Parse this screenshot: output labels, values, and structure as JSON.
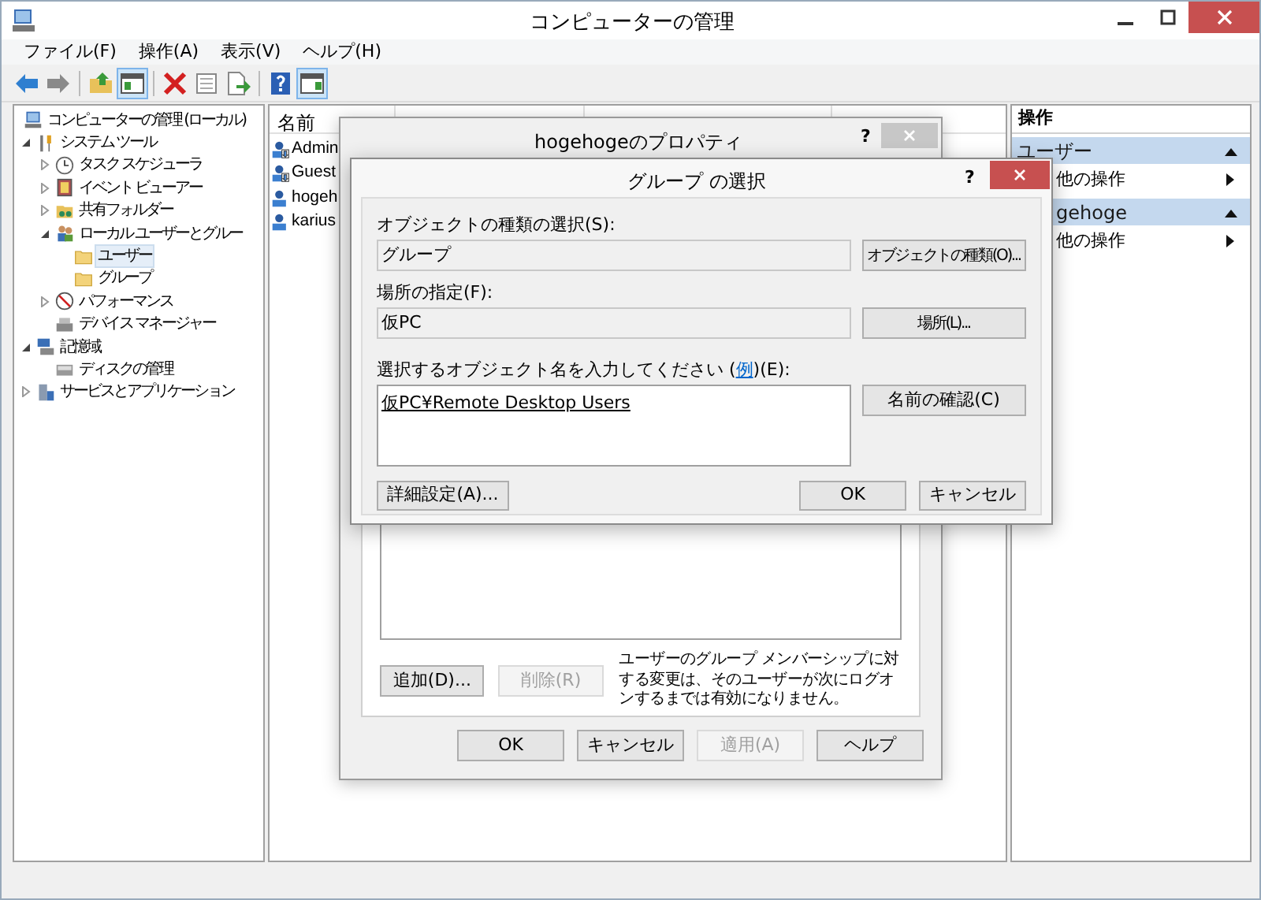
{
  "window": {
    "title": "コンピューターの管理"
  },
  "menu": [
    "ファイル(F)",
    "操作(A)",
    "表示(V)",
    "ヘルプ(H)"
  ],
  "toolbar": [
    [
      {
        "kind": "back",
        "pressed": false
      },
      {
        "kind": "forward",
        "pressed": false
      }
    ],
    [
      {
        "kind": "up",
        "pressed": false
      },
      {
        "kind": "tree",
        "pressed": true
      }
    ],
    [
      {
        "kind": "delete",
        "pressed": false
      },
      {
        "kind": "properties",
        "pressed": false
      },
      {
        "kind": "export",
        "pressed": false
      }
    ],
    [
      {
        "kind": "help",
        "pressed": false
      },
      {
        "kind": "action-pane",
        "pressed": true
      }
    ]
  ],
  "tree": [
    {
      "label": "コンピューターの管理 (ローカル)",
      "kind": "computer",
      "selected": false,
      "children": [
        {
          "label": "システム ツール",
          "kind": "tools",
          "expanded": true,
          "selected": false,
          "children": [
            {
              "label": "タスク スケジューラ",
              "kind": "clock",
              "expanded": false,
              "selected": false
            },
            {
              "label": "イベント ビューアー",
              "kind": "event",
              "expanded": false,
              "selected": false
            },
            {
              "label": "共有フォルダー",
              "kind": "share",
              "expanded": false,
              "selected": false
            },
            {
              "label": "ローカル ユーザーとグルー",
              "kind": "users",
              "expanded": true,
              "selected": false,
              "children": [
                {
                  "label": "ユーザー",
                  "kind": "folder",
                  "selected": true
                },
                {
                  "label": "グループ",
                  "kind": "folder",
                  "selected": false
                }
              ]
            },
            {
              "label": "パフォーマンス",
              "kind": "performance",
              "expanded": false,
              "selected": false
            },
            {
              "label": "デバイス マネージャー",
              "kind": "device",
              "selected": false
            }
          ]
        },
        {
          "label": "記憶域",
          "kind": "storage",
          "expanded": true,
          "selected": false,
          "children": [
            {
              "label": "ディスクの管理",
              "kind": "disk",
              "selected": false
            }
          ]
        },
        {
          "label": "サービスとアプリケーション",
          "kind": "services",
          "expanded": false,
          "selected": false
        }
      ]
    }
  ],
  "list": {
    "column": "名前",
    "rows": [
      {
        "name": "Admin",
        "disabled": true
      },
      {
        "name": "Guest",
        "disabled": true
      },
      {
        "name": "hogeh",
        "disabled": false
      },
      {
        "name": "karius",
        "disabled": false
      }
    ]
  },
  "actions": {
    "title": "操作",
    "sections": [
      {
        "title": "ユーザー",
        "expanded": true,
        "items": [
          "他の操作"
        ]
      },
      {
        "title": "gehoge",
        "expanded": true,
        "items": [
          "他の操作"
        ]
      }
    ]
  },
  "properties_dialog": {
    "title": "hogehogeのプロパティ",
    "help_glyph": "?",
    "list_buttons": [
      {
        "label": "追加(D)...",
        "disabled": false
      },
      {
        "label": "削除(R)",
        "disabled": true
      }
    ],
    "note": "ユーザーのグループ メンバーシップに対する変更は、そのユーザーが次にログオンするまでは有効になりません。",
    "buttons": [
      {
        "label": "OK",
        "disabled": false
      },
      {
        "label": "キャンセル",
        "disabled": false
      },
      {
        "label": "適用(A)",
        "disabled": true
      },
      {
        "label": "ヘルプ",
        "disabled": false
      }
    ]
  },
  "select_dialog": {
    "title": "グループ の選択",
    "help_glyph": "?",
    "fields": [
      {
        "label": "オブジェクトの種類の選択(S):",
        "value": "グループ",
        "button": "オブジェクトの種類(O)..."
      },
      {
        "label": "場所の指定(F):",
        "value": "仮PC",
        "button": "場所(L)..."
      }
    ],
    "names": {
      "label_before": "選択するオブジェクト名を入力してください (",
      "link": "例",
      "label_after": ")(E):",
      "value": "仮PC¥Remote Desktop Users",
      "button": "名前の確認(C)"
    },
    "advanced": "詳細設定(A)...",
    "buttons": [
      "OK",
      "キャンセル"
    ]
  }
}
